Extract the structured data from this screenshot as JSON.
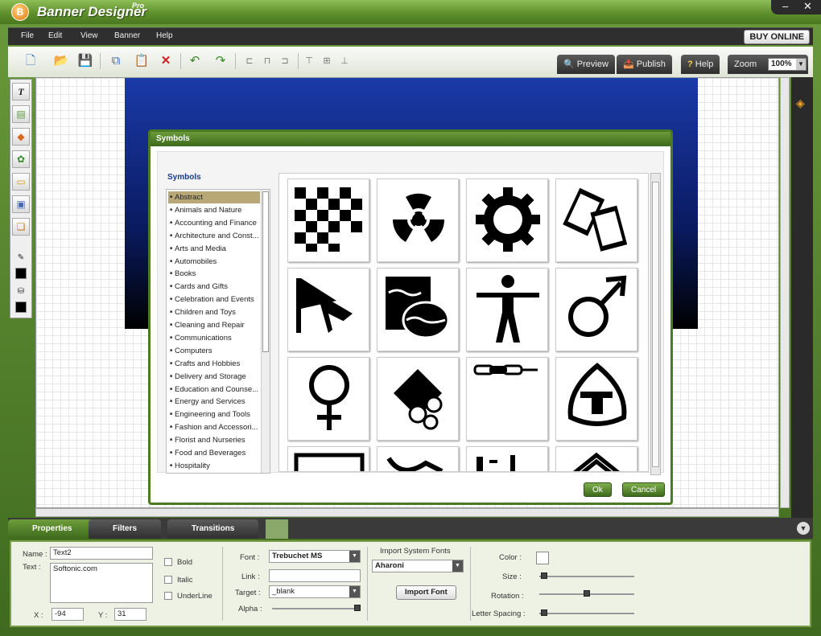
{
  "app": {
    "title": "Banner Designer",
    "edition": "Pro"
  },
  "menu": {
    "items": [
      "File",
      "Edit",
      "View",
      "Banner",
      "Help"
    ],
    "buy": "BUY ONLINE"
  },
  "toolbar": {
    "preview": "Preview",
    "publish": "Publish",
    "help": "Help",
    "zoom_label": "Zoom",
    "zoom_value": "100%"
  },
  "dialog": {
    "title": "Symbols",
    "heading": "Symbols",
    "categories": [
      "Abstract",
      "Animals and Nature",
      "Accounting and Finance",
      "Architecture and Const...",
      "Arts and Media",
      "Automobiles",
      "Books",
      "Cards and Gifts",
      "Celebration and Events",
      "Children and Toys",
      "Cleaning and Repair",
      "Communications",
      "Computers",
      "Crafts and Hobbies",
      "Delivery and Storage",
      "Education and Counse...",
      "Energy and Services",
      "Engineering and Tools",
      "Fashion and Accessori...",
      "Florist and Nurseries",
      "Food and Beverages",
      "Hospitality"
    ],
    "selected_index": 0,
    "ok": "Ok",
    "cancel": "Cancel"
  },
  "tabs": [
    "Properties",
    "Filters",
    "Transitions"
  ],
  "props": {
    "name_label": "Name :",
    "name_value": "Text2",
    "text_label": "Text :",
    "text_value": "Softonic.com",
    "x_label": "X :",
    "x_value": "-94",
    "y_label": "Y :",
    "y_value": "31",
    "bold": "Bold",
    "italic": "Italic",
    "underline": "UnderLine",
    "font_label": "Font :",
    "font_value": "Trebuchet MS",
    "link_label": "Link :",
    "link_value": "",
    "target_label": "Target :",
    "target_value": "_blank",
    "alpha_label": "Alpha :",
    "alpha_level": 1.0,
    "import_label": "Import System Fonts",
    "import_value": "Aharoni",
    "import_button": "Import Font",
    "color_label": "Color :",
    "size_label": "Size :",
    "size_level": 0.05,
    "rotation_label": "Rotation :",
    "rotation_level": 0.5,
    "spacing_label": "Letter Spacing :",
    "spacing_level": 0.05
  }
}
